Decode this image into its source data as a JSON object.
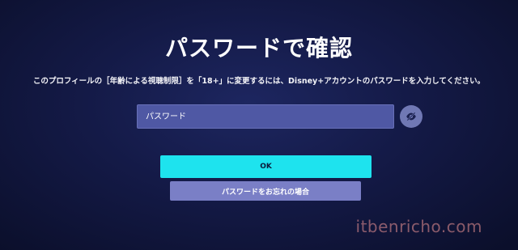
{
  "dialog": {
    "title": "パスワードで確認",
    "message": "このプロフィールの［年齢による視聴制限］を「18+」に変更するには、Disney+アカウントのパスワードを入力してください。"
  },
  "password_field": {
    "placeholder": "パスワード",
    "value": ""
  },
  "reveal_icon": "eye-slash-icon",
  "buttons": {
    "ok_label": "OK",
    "forgot_label": "パスワードをお忘れの場合"
  },
  "watermark": "itbenricho.com",
  "colors": {
    "accent": "#1ee3ee",
    "field_background": "#4f58a4",
    "secondary_button": "#7a7fc6",
    "background": "#141a47"
  }
}
